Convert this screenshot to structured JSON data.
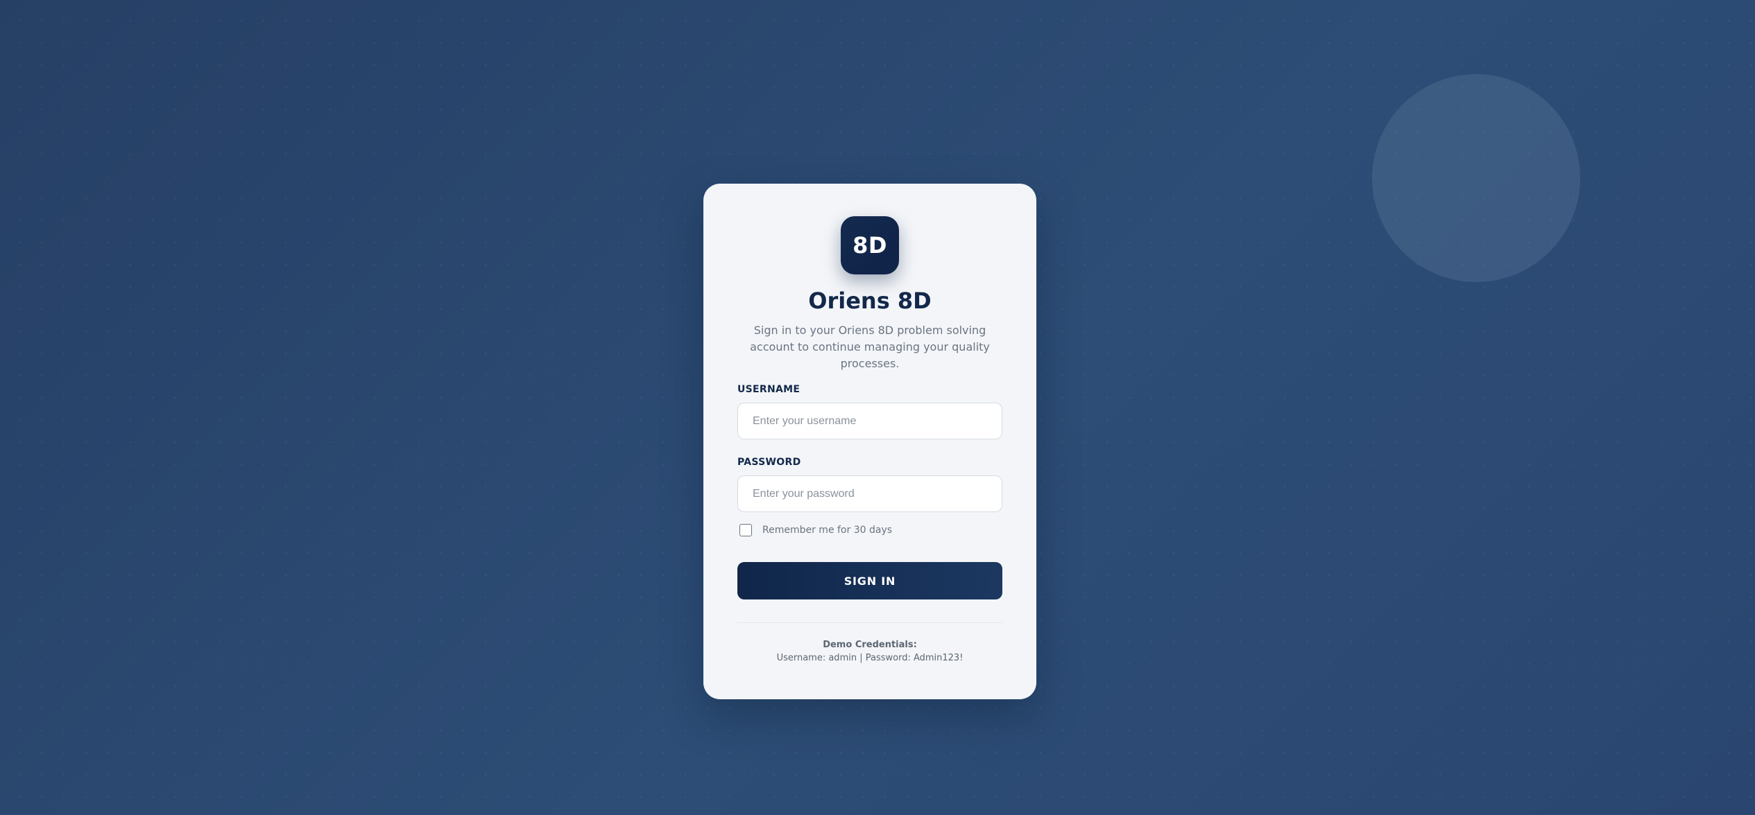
{
  "brand": {
    "logo_text": "8D",
    "title": "Oriens 8D",
    "subtitle": "Sign in to your Oriens 8D problem solving account to continue managing your quality processes."
  },
  "form": {
    "username": {
      "label": "USERNAME",
      "placeholder": "Enter your username",
      "value": ""
    },
    "password": {
      "label": "PASSWORD",
      "placeholder": "Enter your password",
      "value": ""
    },
    "remember": {
      "label": "Remember me for 30 days",
      "checked": false
    },
    "submit_label": "SIGN IN"
  },
  "demo": {
    "title": "Demo Credentials:",
    "credentials": "Username: admin | Password: Admin123!"
  },
  "colors": {
    "background": "#2b4870",
    "card": "#f3f5f8",
    "primary": "#13284a",
    "muted_text": "#6a7482"
  }
}
